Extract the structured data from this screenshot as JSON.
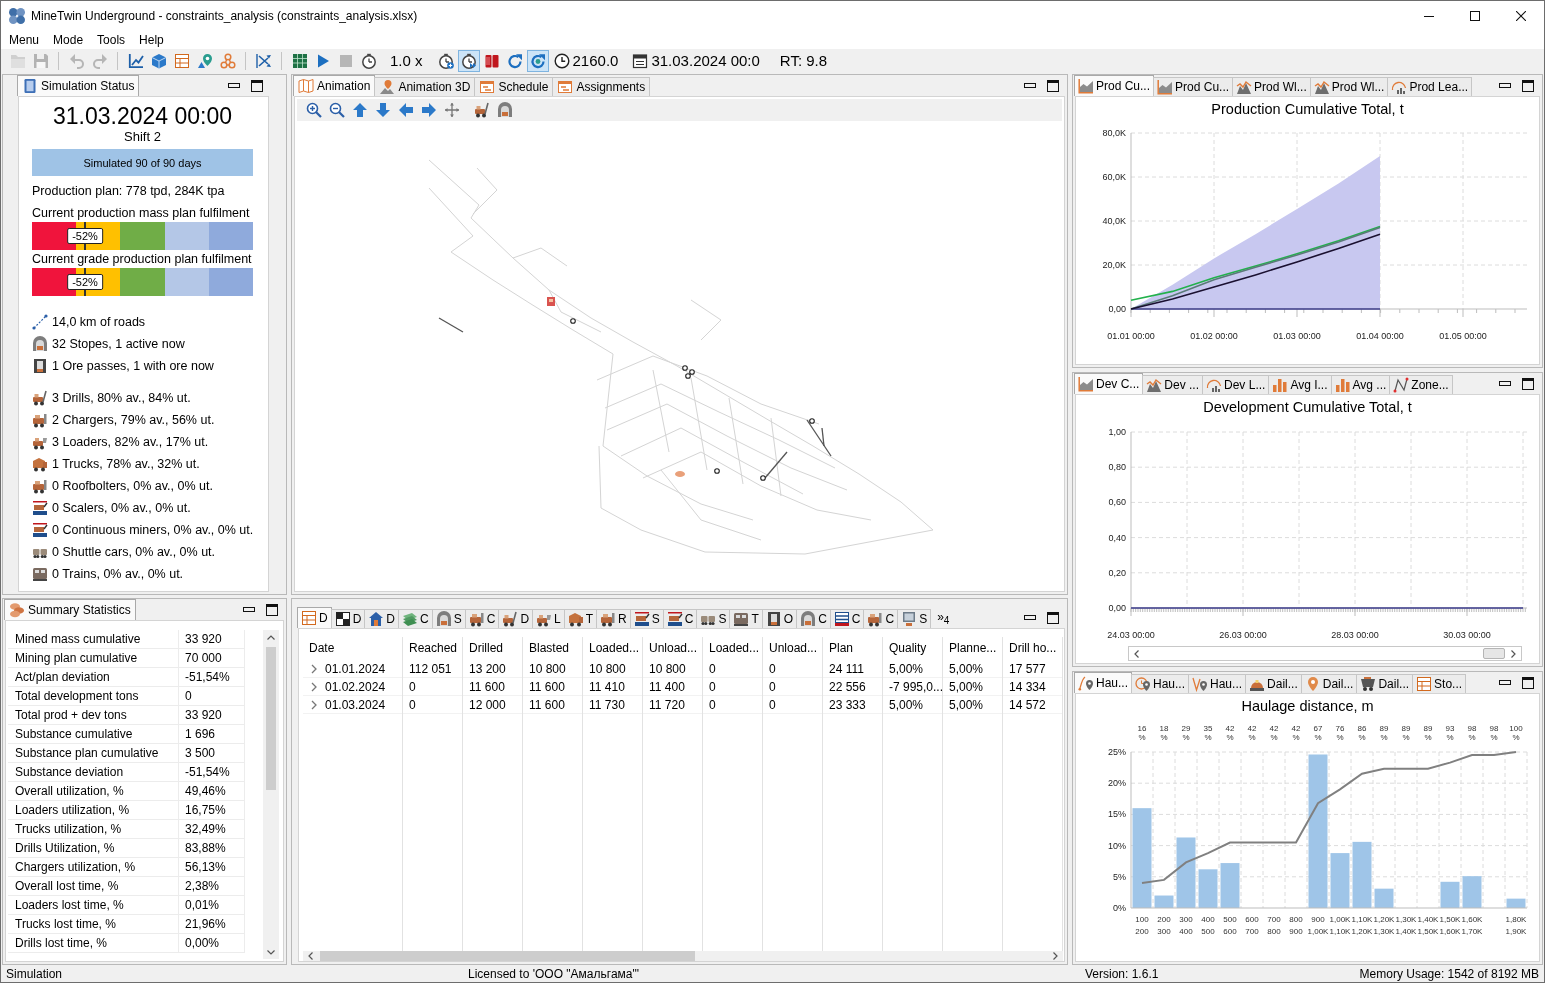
{
  "window": {
    "title": "MineTwin Underground - constraints_analysis (constraints_analysis.xlsx)"
  },
  "menu": [
    "Menu",
    "Mode",
    "Tools",
    "Help"
  ],
  "toolbar": [
    {
      "kind": "button",
      "pressed": false,
      "disabled": true
    },
    {
      "kind": "button",
      "pressed": false,
      "disabled": true
    },
    {
      "kind": "separator"
    },
    {
      "kind": "button",
      "pressed": false,
      "disabled": true
    },
    {
      "kind": "button",
      "pressed": false,
      "disabled": true
    },
    {
      "kind": "separator"
    },
    {
      "kind": "button",
      "pressed": false,
      "disabled": false
    },
    {
      "kind": "button",
      "pressed": false,
      "disabled": false
    },
    {
      "kind": "button",
      "pressed": false,
      "disabled": false
    },
    {
      "kind": "button",
      "pressed": false,
      "disabled": false
    },
    {
      "kind": "button",
      "pressed": false,
      "disabled": false
    },
    {
      "kind": "separator"
    },
    {
      "kind": "button",
      "pressed": false,
      "disabled": false
    },
    {
      "kind": "separator"
    },
    {
      "kind": "button",
      "pressed": false,
      "disabled": false
    },
    {
      "kind": "button",
      "pressed": false,
      "disabled": false
    },
    {
      "kind": "button",
      "pressed": false,
      "disabled": true
    },
    {
      "kind": "button",
      "pressed": false,
      "disabled": false
    },
    {
      "kind": "readout",
      "text": "1.0 x"
    },
    {
      "kind": "button",
      "pressed": false,
      "disabled": false
    },
    {
      "kind": "button",
      "pressed": true,
      "disabled": false
    },
    {
      "kind": "button",
      "pressed": false,
      "disabled": false
    },
    {
      "kind": "button",
      "pressed": false,
      "disabled": false
    },
    {
      "kind": "button",
      "pressed": true,
      "disabled": false
    },
    {
      "kind": "icon-readout",
      "text": "2160.0"
    },
    {
      "kind": "icon-readout",
      "text": "31.03.2024 00:0"
    },
    {
      "kind": "readout",
      "text": "RT: 9.8"
    }
  ],
  "simulation_status_panel": {
    "tabs": [
      {
        "label": "Simulation Status",
        "selected": true
      }
    ],
    "date": "31.03.2024 00:00",
    "shift": "Shift 2",
    "progress": {
      "text": "Simulated 90 of 90 days",
      "level": 1
    },
    "production_plan": "Production plan: 778 tpd, 284K tpa",
    "gauges": [
      {
        "label": "Current production mass plan fulfilment",
        "marker_label": "-52%",
        "level": 0.24,
        "segments": [
          {
            "color": "#f0143c"
          },
          {
            "color": "#ffc000"
          },
          {
            "color": "#70ad47"
          },
          {
            "color": "#b4c7e7"
          },
          {
            "color": "#8faadc"
          }
        ]
      },
      {
        "label": "Current grade production plan fulfilment",
        "marker_label": "-52%",
        "level": 0.24,
        "segments": [
          {
            "color": "#f0143c"
          },
          {
            "color": "#ffc000"
          },
          {
            "color": "#70ad47"
          },
          {
            "color": "#b4c7e7"
          },
          {
            "color": "#8faadc"
          }
        ]
      }
    ],
    "infrastructure": [
      "14,0 km of roads",
      "32 Stopes, 1 active now",
      "1 Ore passes, 1 with ore now"
    ],
    "equipment": [
      "3 Drills, 80% av., 84% ut.",
      "2 Chargers, 79% av., 56% ut.",
      "3 Loaders, 82% av., 17% ut.",
      "1 Trucks, 78% av., 32% ut.",
      "0 Roofbolters, 0% av., 0% ut.",
      "0 Scalers, 0% av., 0% ut.",
      "0 Continuous miners, 0% av., 0% ut.",
      "0 Shuttle cars, 0% av., 0% ut.",
      "0 Trains, 0% av., 0% ut."
    ]
  },
  "summary_statistics_panel": {
    "tabs": [
      {
        "label": "Summary Statistics",
        "selected": true
      }
    ],
    "rows": [
      {
        "label": "Mined mass cumulative",
        "value": "33 920"
      },
      {
        "label": "Mining plan cumulative",
        "value": "70 000"
      },
      {
        "label": "Act/plan deviation",
        "value": "-51,54%"
      },
      {
        "label": "Total development tons",
        "value": "0"
      },
      {
        "label": "Total prod + dev tons",
        "value": "33 920"
      },
      {
        "label": "Substance cumulative",
        "value": "1 696"
      },
      {
        "label": "Substance plan cumulative",
        "value": "3 500"
      },
      {
        "label": "Substance deviation",
        "value": "-51,54%"
      },
      {
        "label": "Overall utilization, %",
        "value": "49,46%"
      },
      {
        "label": "Loaders utilization, %",
        "value": "16,75%"
      },
      {
        "label": "Trucks utilization, %",
        "value": "32,49%"
      },
      {
        "label": "Drills Utilization, %",
        "value": "83,88%"
      },
      {
        "label": "Chargers utilization, %",
        "value": "56,13%"
      },
      {
        "label": "Overall lost time, %",
        "value": "2,38%"
      },
      {
        "label": "Loaders lost time, %",
        "value": "0,01%"
      },
      {
        "label": "Trucks lost time, %",
        "value": "21,96%"
      },
      {
        "label": "Drills lost time, %",
        "value": "0,00%"
      }
    ]
  },
  "animation_panel": {
    "tabs": [
      {
        "label": "Animation",
        "selected": true
      },
      {
        "label": "Animation 3D",
        "selected": false
      },
      {
        "label": "Schedule",
        "selected": false
      },
      {
        "label": "Assignments",
        "selected": false
      }
    ]
  },
  "report_panel": {
    "tabs": [
      {
        "label": "D",
        "selected": true
      },
      {
        "label": "D",
        "selected": false
      },
      {
        "label": "D",
        "selected": false
      },
      {
        "label": "C",
        "selected": false
      },
      {
        "label": "S",
        "selected": false
      },
      {
        "label": "C",
        "selected": false
      },
      {
        "label": "D",
        "selected": false
      },
      {
        "label": "L",
        "selected": false
      },
      {
        "label": "T",
        "selected": false
      },
      {
        "label": "R",
        "selected": false
      },
      {
        "label": "S",
        "selected": false
      },
      {
        "label": "C",
        "selected": false
      },
      {
        "label": "S",
        "selected": false
      },
      {
        "label": "T",
        "selected": false
      },
      {
        "label": "O",
        "selected": false
      },
      {
        "label": "C",
        "selected": false
      },
      {
        "label": "C",
        "selected": false
      },
      {
        "label": "C",
        "selected": false
      },
      {
        "label": "S",
        "selected": false
      }
    ],
    "overflow": "»$_{4}$",
    "table": {
      "columns": [
        "Date",
        "Reached",
        "Drilled",
        "Blasted",
        "Loaded...",
        "Unload...",
        "Loaded...",
        "Unload...",
        "Plan",
        "Quality",
        "Planne...",
        "Drill ho..."
      ],
      "rows": [
        {
          "expanded": false,
          "cells": [
            "01.01.2024",
            "112 051",
            "13 200",
            "10 800",
            "10 800",
            "10 800",
            "0",
            "0",
            "24 111",
            "5,00%",
            "5,00%",
            "17 577"
          ]
        },
        {
          "expanded": false,
          "cells": [
            "01.02.2024",
            "0",
            "11 600",
            "11 600",
            "11 410",
            "11 400",
            "0",
            "0",
            "22 556",
            "-7 995,0...",
            "5,00%",
            "14 334"
          ]
        },
        {
          "expanded": false,
          "cells": [
            "01.03.2024",
            "0",
            "12 000",
            "11 600",
            "11 730",
            "11 720",
            "0",
            "0",
            "23 333",
            "5,00%",
            "5,00%",
            "14 572"
          ]
        }
      ]
    }
  },
  "production_chart_panel": {
    "tabs": [
      {
        "label": "Prod Cu...",
        "selected": true
      },
      {
        "label": "Prod Cu...",
        "selected": false
      },
      {
        "label": "Prod Wl...",
        "selected": false
      },
      {
        "label": "Prod Wl...",
        "selected": false
      },
      {
        "label": "Prod Lea...",
        "selected": false
      }
    ],
    "chart_data": {
      "type": "line",
      "title": "Production Cumulative Total, t",
      "grid": true,
      "categories": [
        "01.01 00:00",
        null,
        "01.02 00:00",
        null,
        "01.03 00:00",
        null,
        "01.04 00:00",
        null,
        "01.05 00:00"
      ],
      "series": [
        {
          "type": "area",
          "color": "#c8c8f0",
          "values": [
            0,
            11000,
            23000,
            34000,
            45500,
            57000,
            69500,
            null,
            null
          ]
        },
        {
          "color": "#3c3c8c",
          "values": [
            0,
            0,
            0,
            0,
            0,
            0,
            0,
            null,
            null
          ]
        },
        {
          "color": "#22b14c",
          "values": [
            4000,
            8000,
            14200,
            19500,
            25100,
            31000,
            37500,
            null,
            null
          ]
        },
        {
          "color": "#5a7a78",
          "values": [
            0,
            6000,
            13300,
            19000,
            24500,
            30500,
            37000,
            null,
            null
          ]
        },
        {
          "color": "#1a1030",
          "values": [
            0,
            4500,
            10000,
            15500,
            21400,
            27500,
            34000,
            null,
            null
          ]
        }
      ],
      "ylim": [
        0,
        80000
      ],
      "yticks": [
        {
          "value": 0,
          "label": "0,00"
        },
        {
          "value": 20000,
          "label": "20,0K"
        },
        {
          "value": 40000,
          "label": "40,0K"
        },
        {
          "value": 60000,
          "label": "60,0K"
        },
        {
          "value": 80000,
          "label": "80,0K"
        }
      ]
    }
  },
  "development_chart_panel": {
    "tabs": [
      {
        "label": "Dev C...",
        "selected": true
      },
      {
        "label": "Dev ...",
        "selected": false
      },
      {
        "label": "Dev L...",
        "selected": false
      },
      {
        "label": "Avg I...",
        "selected": false
      },
      {
        "label": "Avg ...",
        "selected": false
      },
      {
        "label": "Zone...",
        "selected": false
      }
    ],
    "chart_data": {
      "type": "line",
      "title": "Development Cumulative Total, t",
      "grid": true,
      "categories": [
        "24.03 00:00",
        null,
        "26.03 00:00",
        null,
        "28.03 00:00",
        null,
        "30.03 00:00",
        null
      ],
      "series": [
        {
          "color": "#3c3c8c",
          "values": [
            0,
            0,
            0,
            0,
            0,
            0,
            0,
            0
          ]
        }
      ],
      "ylim": [
        0,
        1
      ],
      "yticks": [
        {
          "value": 0,
          "label": "0,00"
        },
        {
          "value": 0.2,
          "label": "0,20"
        },
        {
          "value": 0.4,
          "label": "0,40"
        },
        {
          "value": 0.6,
          "label": "0,60"
        },
        {
          "value": 0.8,
          "label": "0,80"
        },
        {
          "value": 1,
          "label": "1,00"
        }
      ]
    }
  },
  "haulage_chart_panel": {
    "tabs": [
      {
        "label": "Hau...",
        "selected": true
      },
      {
        "label": "Hau...",
        "selected": false
      },
      {
        "label": "Hau...",
        "selected": false
      },
      {
        "label": "Dail...",
        "selected": false
      },
      {
        "label": "Dail...",
        "selected": false
      },
      {
        "label": "Dail...",
        "selected": false
      },
      {
        "label": "Sto...",
        "selected": false
      }
    ],
    "bins": [
      {
        "cumulative": "16",
        "unit": "%",
        "end_label": "200"
      },
      {
        "cumulative": "18",
        "unit": "%",
        "end_label": "300"
      },
      {
        "cumulative": "29",
        "unit": "%",
        "end_label": "400"
      },
      {
        "cumulative": "35",
        "unit": "%",
        "end_label": "500"
      },
      {
        "cumulative": "42",
        "unit": "%",
        "end_label": "600"
      },
      {
        "cumulative": "42",
        "unit": "%",
        "end_label": "700"
      },
      {
        "cumulative": "42",
        "unit": "%",
        "end_label": "800"
      },
      {
        "cumulative": "42",
        "unit": "%",
        "end_label": "900"
      },
      {
        "cumulative": "67",
        "unit": "%",
        "end_label": "1,00K"
      },
      {
        "cumulative": "76",
        "unit": "%",
        "end_label": "1,10K"
      },
      {
        "cumulative": "86",
        "unit": "%",
        "end_label": "1,20K"
      },
      {
        "cumulative": "89",
        "unit": "%",
        "end_label": "1,30K"
      },
      {
        "cumulative": "89",
        "unit": "%",
        "end_label": "1,40K"
      },
      {
        "cumulative": "89",
        "unit": "%",
        "end_label": "1,50K"
      },
      {
        "cumulative": "93",
        "unit": "%",
        "end_label": "1,60K"
      },
      {
        "cumulative": "98",
        "unit": "%",
        "end_label": "1,70K"
      },
      {
        "cumulative": "98",
        "unit": "%"
      },
      {
        "cumulative": "100",
        "unit": "%",
        "end_label": "1,90K"
      }
    ],
    "chart_data": {
      "type": "bar",
      "title": "Haulage distance, m",
      "grid": true,
      "categories": [
        "100",
        "200",
        "300",
        "400",
        "500",
        "600",
        "700",
        "800",
        "900",
        "1,00K",
        "1,10K",
        "1,20K",
        "1,30K",
        "1,40K",
        "1,50K",
        "1,60K",
        null,
        "1,80K"
      ],
      "series": [
        {
          "color": "#9fc5e8",
          "values": [
            16,
            2,
            11.3,
            6.2,
            7.2,
            0,
            0,
            0,
            24.6,
            8.8,
            10.6,
            3.1,
            0,
            0,
            4.2,
            5.1,
            0,
            1.5
          ]
        },
        {
          "type": "line",
          "color": "#808080",
          "values": [
            4,
            4.5,
            7.3,
            8.8,
            10.5,
            10.5,
            10.5,
            10.5,
            16.8,
            19,
            21.5,
            22.3,
            22.3,
            22.3,
            23.3,
            24.5,
            24.5,
            25
          ]
        }
      ],
      "ylim": [
        0,
        25
      ],
      "yticks": [
        {
          "value": 0,
          "label": "0%"
        },
        {
          "value": 5,
          "label": "5%"
        },
        {
          "value": 10,
          "label": "10%"
        },
        {
          "value": 15,
          "label": "15%"
        },
        {
          "value": 20,
          "label": "20%"
        },
        {
          "value": 25,
          "label": "25%"
        }
      ]
    }
  },
  "status_bar": {
    "mode": "Simulation",
    "license": "Licensed to 'ООО \"Амальгама\"'",
    "version": "Version: 1.6.1",
    "memory": "Memory Usage: 1542 of 8192 MB"
  }
}
